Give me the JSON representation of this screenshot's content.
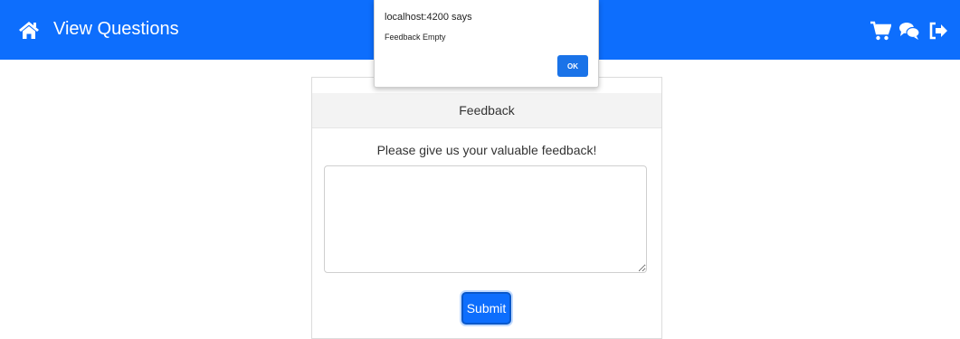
{
  "navbar": {
    "title": "View Questions",
    "home_icon": "home-icon",
    "right_icons": [
      "cart-icon",
      "chat-icon",
      "logout-icon"
    ],
    "background": "#0d6efd"
  },
  "feedback_card": {
    "header": "Feedback",
    "prompt": "Please give us your valuable feedback!",
    "textarea_value": "",
    "submit_label": "Submit"
  },
  "alert_dialog": {
    "title": "localhost:4200 says",
    "message": "Feedback Empty",
    "ok_label": "OK"
  }
}
